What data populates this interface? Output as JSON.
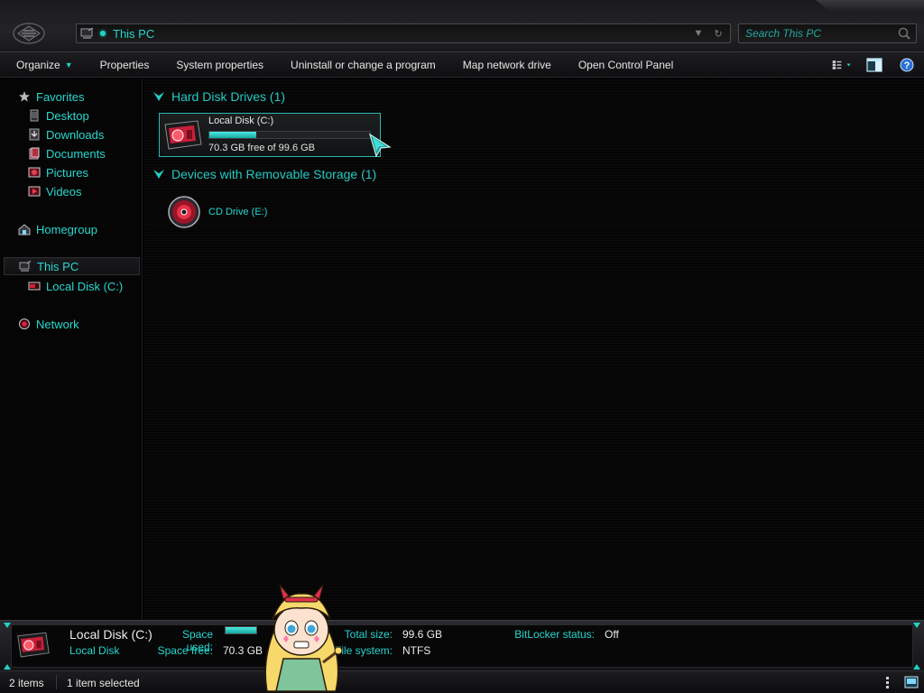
{
  "window": {
    "address_path": "This PC",
    "search_placeholder": "Search This PC"
  },
  "toolbar": {
    "items": [
      "Organize",
      "Properties",
      "System properties",
      "Uninstall or change a program",
      "Map network drive",
      "Open Control Panel"
    ]
  },
  "nav": {
    "favorites": "Favorites",
    "desktop": "Desktop",
    "downloads": "Downloads",
    "documents": "Documents",
    "pictures": "Pictures",
    "videos": "Videos",
    "homegroup": "Homegroup",
    "this_pc": "This PC",
    "local_disk": "Local Disk (C:)",
    "network": "Network"
  },
  "content": {
    "group_hdd": "Hard Disk Drives (1)",
    "group_removable": "Devices with Removable Storage (1)",
    "drive": {
      "name": "Local Disk (C:)",
      "free_text": "70.3 GB free of 99.6 GB",
      "used_fraction": 0.29
    },
    "cd_drive": "CD Drive (E:)"
  },
  "details": {
    "title": "Local Disk (C:)",
    "subtitle": "Local Disk",
    "space_used_label": "Space used:",
    "space_free_label": "Space free:",
    "space_free_value": "70.3 GB",
    "total_size_label": "Total size:",
    "total_size_value": "99.6 GB",
    "file_system_label": "File system:",
    "file_system_value": "NTFS",
    "bitlocker_label": "BitLocker status:",
    "bitlocker_value": "Off"
  },
  "status": {
    "item_count": "2 items",
    "selected": "1 item selected"
  },
  "colors": {
    "accent": "#26d6cf",
    "background": "#050505",
    "drive_red": "#c8203a"
  }
}
